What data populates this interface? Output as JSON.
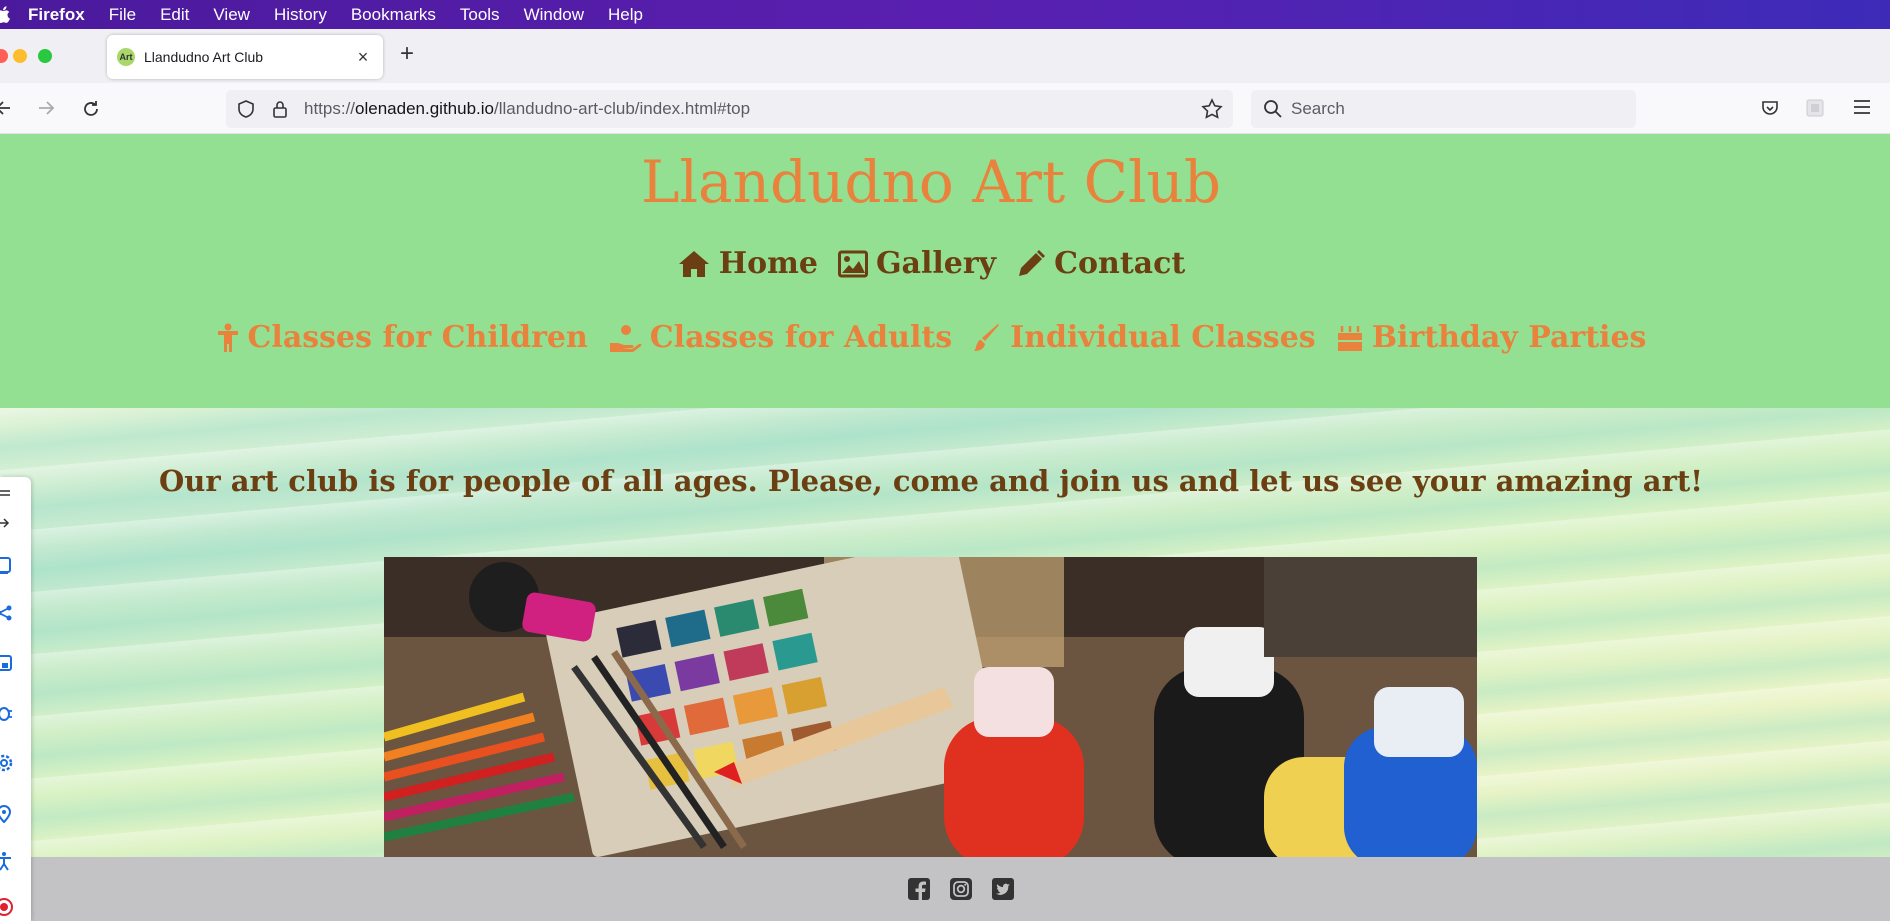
{
  "menubar": {
    "app": "Firefox",
    "items": [
      "File",
      "Edit",
      "View",
      "History",
      "Bookmarks",
      "Tools",
      "Window",
      "Help"
    ]
  },
  "tab": {
    "favicon_text": "Art",
    "title": "Llandudno Art Club",
    "close": "×",
    "new_tab": "+"
  },
  "urlbar": {
    "scheme": "https://",
    "domain": "olenaden.github.io",
    "path": "/llandudno-art-club/index.html#top"
  },
  "search": {
    "placeholder": "Search"
  },
  "site": {
    "title": "Llandudno Art Club",
    "nav_main": [
      {
        "icon": "home-icon",
        "label": "Home"
      },
      {
        "icon": "image-icon",
        "label": "Gallery"
      },
      {
        "icon": "pencil-icon",
        "label": "Contact"
      }
    ],
    "nav_classes": [
      {
        "icon": "child-icon",
        "label": "Classes for Children"
      },
      {
        "icon": "hand-holding-icon",
        "label": "Classes for Adults"
      },
      {
        "icon": "paintbrush-icon",
        "label": "Individual Classes"
      },
      {
        "icon": "birthday-cake-icon",
        "label": "Birthday Parties"
      }
    ],
    "tagline": "Our art club is for people of all ages. Please, come and join us and let us see your amazing art!",
    "footer_social": [
      "facebook-icon",
      "instagram-icon",
      "twitter-icon"
    ]
  },
  "colors": {
    "header_bg": "#93e092",
    "accent_orange": "#e8823d",
    "brown": "#6b3f12",
    "footer_bg": "#c3c3c6"
  }
}
